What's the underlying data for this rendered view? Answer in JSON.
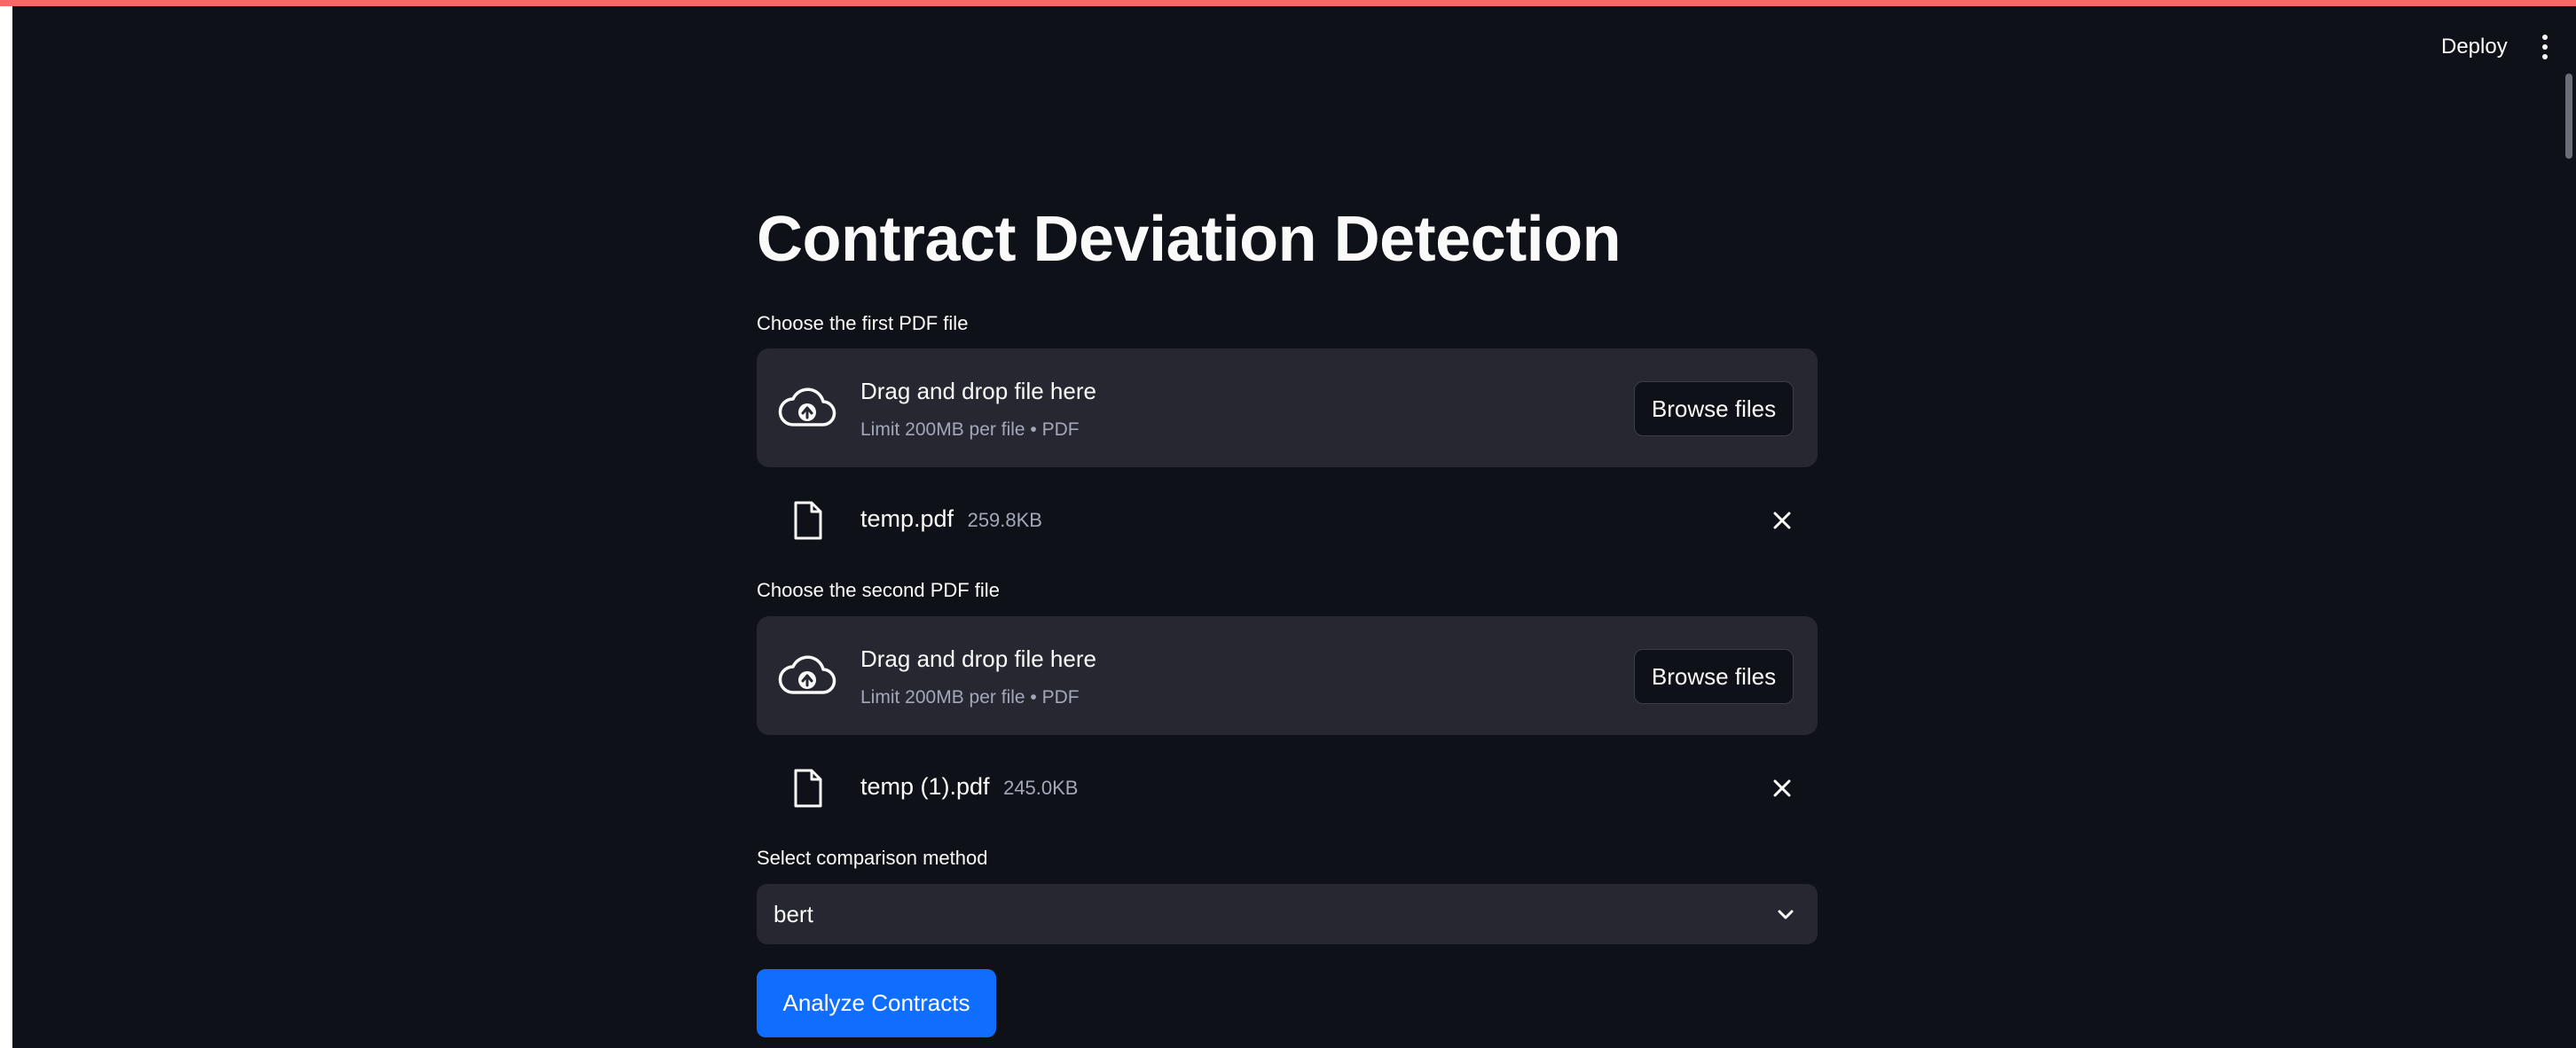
{
  "header": {
    "deploy_label": "Deploy",
    "menu_icon": "vertical-ellipsis-icon"
  },
  "page": {
    "title": "Contract Deviation Detection"
  },
  "uploader1": {
    "label": "Choose the first PDF file",
    "drop_title": "Drag and drop file here",
    "drop_subtitle": "Limit 200MB per file • PDF",
    "browse_label": "Browse files",
    "file": {
      "name": "temp.pdf",
      "size": "259.8KB"
    }
  },
  "uploader2": {
    "label": "Choose the second PDF file",
    "drop_title": "Drag and drop file here",
    "drop_subtitle": "Limit 200MB per file • PDF",
    "browse_label": "Browse files",
    "file": {
      "name": "temp (1).pdf",
      "size": "245.0KB"
    }
  },
  "method": {
    "label": "Select comparison method",
    "selected": "bert"
  },
  "analyze_button": {
    "label": "Analyze Contracts"
  },
  "colors": {
    "background": "#0e1117",
    "panel": "#262730",
    "accent": "#0f6efd",
    "text": "#fafafa",
    "muted_text": "#a3a8b8"
  }
}
